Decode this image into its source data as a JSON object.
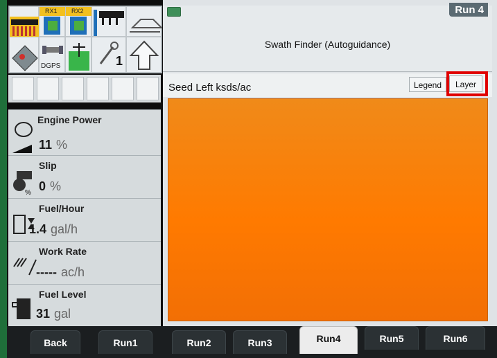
{
  "app": {
    "run_label": "Run 4",
    "header_title": "Swath Finder (Autoguidance)",
    "layer_title": "Seed Left ksds/ac",
    "legend_label": "Legend",
    "layer_label": "Layer"
  },
  "status_icons": {
    "rx1_label": "RX1",
    "rx2_label": "RX2",
    "dgps_label": "DGPS",
    "wrench_number": "1"
  },
  "readouts": [
    {
      "title": "Engine Power",
      "value": "11",
      "unit": "%"
    },
    {
      "title": "Slip",
      "value": "0",
      "unit": "%"
    },
    {
      "title": "Fuel/Hour",
      "value": "1.4",
      "unit": "gal/h"
    },
    {
      "title": "Work Rate",
      "value": "-----",
      "unit": "ac/h"
    },
    {
      "title": "Fuel Level",
      "value": "31",
      "unit": "gal"
    }
  ],
  "tabs": [
    {
      "label": "Back"
    },
    {
      "label": "Run1"
    },
    {
      "label": "Run2"
    },
    {
      "label": "Run3"
    },
    {
      "label": "Run4",
      "active": true
    },
    {
      "label": "Run5"
    },
    {
      "label": "Run6"
    }
  ],
  "colors": {
    "map_fill": "#ff7a00",
    "highlight": "#e00000",
    "bezel_green": "#1f6f3a"
  }
}
